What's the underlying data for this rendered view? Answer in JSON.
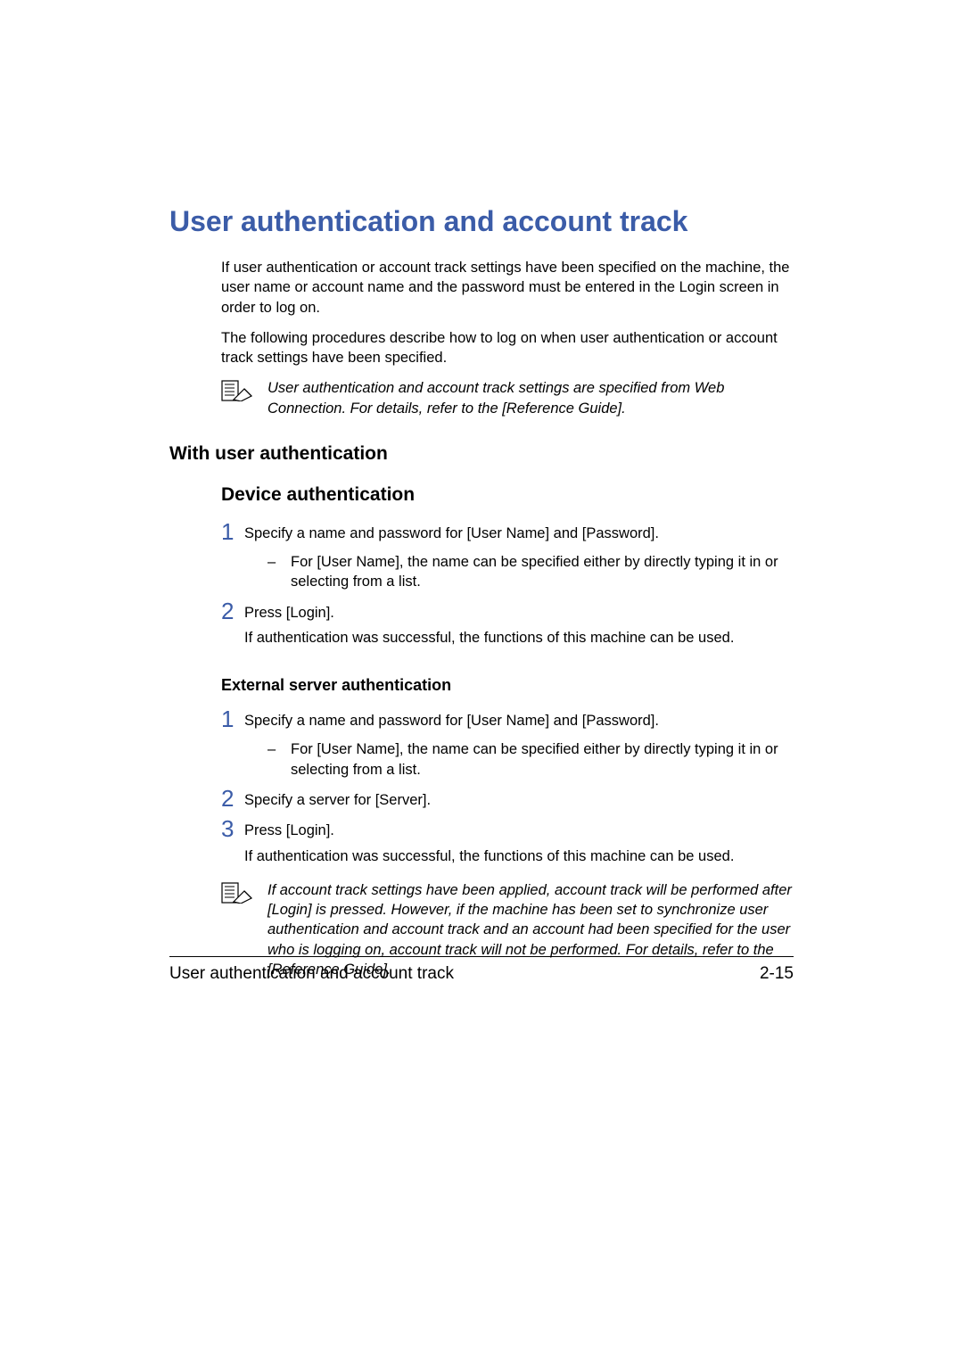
{
  "title": "User authentication and account track",
  "intro": {
    "p1": "If user authentication or account track settings have been specified on the machine, the user name or account name and the password must be entered in the Login screen in order to log on.",
    "p2": "The following procedures describe how to log on when user authentication or account track settings have been specified."
  },
  "note1": "User authentication and account track settings are specified from Web Connection. For details, refer to the [Reference Guide].",
  "sections": {
    "with_user_auth": "With user authentication",
    "device_auth": "Device authentication",
    "external_auth": "External server authentication"
  },
  "steps": {
    "device": [
      {
        "num": "1",
        "text": "Specify a name and password for [User Name] and [Password].",
        "sub": "For [User Name], the name can be specified either by directly typing it in or selecting from a list."
      },
      {
        "num": "2",
        "text": "Press [Login].",
        "after": "If authentication was successful, the functions of this machine can be used."
      }
    ],
    "external": [
      {
        "num": "1",
        "text": "Specify a name and password for [User Name] and [Password].",
        "sub": "For [User Name], the name can be specified either by directly typing it in or selecting from a list."
      },
      {
        "num": "2",
        "text": "Specify a server for [Server]."
      },
      {
        "num": "3",
        "text": "Press [Login].",
        "after": "If authentication was successful, the functions of this machine can be used."
      }
    ]
  },
  "note2": "If account track settings have been applied, account track will be performed after [Login] is pressed. However, if the machine has been set to synchronize user authentication and account track and an account had been specified for the user who is logging on, account track will not be performed. For details, refer to the [Reference Guide].",
  "footer": {
    "left": "User authentication and account track",
    "right": "2-15"
  },
  "dash": "–"
}
